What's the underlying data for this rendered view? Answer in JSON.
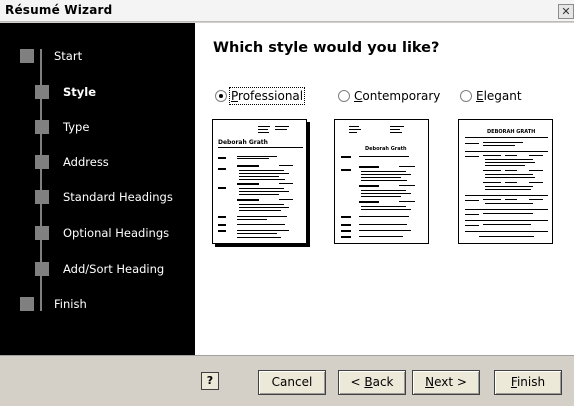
{
  "window": {
    "title": "Résumé Wizard",
    "close_glyph": "✕"
  },
  "sidebar": {
    "steps": [
      {
        "label": "Start",
        "active": false
      },
      {
        "label": "Style",
        "active": true
      },
      {
        "label": "Type",
        "active": false
      },
      {
        "label": "Address",
        "active": false
      },
      {
        "label": "Standard Headings",
        "active": false
      },
      {
        "label": "Optional Headings",
        "active": false
      },
      {
        "label": "Add/Sort Heading",
        "active": false
      },
      {
        "label": "Finish",
        "active": false
      }
    ]
  },
  "main": {
    "question": "Which style would you like?",
    "options": [
      {
        "label": "Professional",
        "mnemonic": "P",
        "rest": "rofessional",
        "selected": true
      },
      {
        "label": "Contemporary",
        "mnemonic": "C",
        "rest": "ontemporary",
        "selected": false
      },
      {
        "label": "Elegant",
        "mnemonic": "E",
        "rest": "legant",
        "selected": false
      }
    ],
    "previews": [
      {
        "style": "professional",
        "name_text": "Deborah Grath"
      },
      {
        "style": "contemporary",
        "name_text": "Deborah Grath"
      },
      {
        "style": "elegant",
        "name_text": "DEBORAH GRATH"
      }
    ]
  },
  "footer": {
    "help_glyph": "?",
    "cancel": "Cancel",
    "back_prefix": "< ",
    "back_mn": "B",
    "back_rest": "ack",
    "next_mn": "N",
    "next_rest": "ext >",
    "finish_mn": "F",
    "finish_rest": "inish"
  },
  "colors": {
    "sidebar_bg": "#000000",
    "step_marker": "#808080",
    "main_bg": "#ffffff",
    "footer_bg": "#d4d0c8"
  }
}
